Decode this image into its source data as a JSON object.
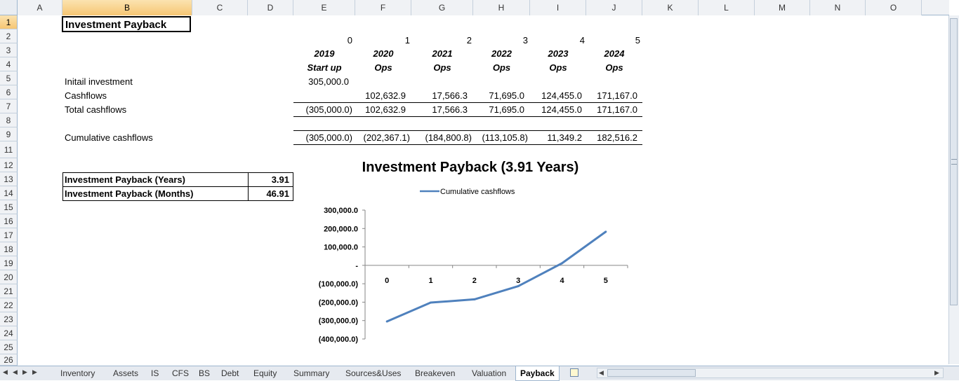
{
  "columns": [
    "A",
    "B",
    "C",
    "D",
    "E",
    "F",
    "G",
    "H",
    "I",
    "J",
    "K",
    "L",
    "M",
    "N",
    "O"
  ],
  "rows": [
    "1",
    "2",
    "3",
    "4",
    "5",
    "6",
    "7",
    "8",
    "9",
    "11",
    "12",
    "13",
    "14",
    "15",
    "16",
    "17",
    "18",
    "19",
    "20",
    "21",
    "22",
    "23",
    "24",
    "25",
    "26"
  ],
  "sheet": {
    "title": "Investment Payback",
    "periods": [
      "0",
      "1",
      "2",
      "3",
      "4",
      "5"
    ],
    "years": [
      "2019",
      "2020",
      "2021",
      "2022",
      "2023",
      "2024"
    ],
    "phases": [
      "Start up",
      "Ops",
      "Ops",
      "Ops",
      "Ops",
      "Ops"
    ],
    "initial_label": "Initail investment",
    "initial_value": "305,000.0",
    "cashflows_label": "Cashflows",
    "cashflows": [
      "102,632.9",
      "17,566.3",
      "71,695.0",
      "124,455.0",
      "171,167.0"
    ],
    "total_label": "Total cashflows",
    "total": [
      "(305,000.0)",
      "102,632.9",
      "17,566.3",
      "71,695.0",
      "124,455.0",
      "171,167.0"
    ],
    "cumulative_label": "Cumulative cashflows",
    "cumulative": [
      "(305,000.0)",
      "(202,367.1)",
      "(184,800.8)",
      "(113,105.8)",
      "11,349.2",
      "182,516.2"
    ],
    "payback_years_label": "Investment Payback (Years)",
    "payback_years_value": "3.91",
    "payback_months_label": "Investment Payback (Months)",
    "payback_months_value": "46.91"
  },
  "chart_data": {
    "type": "line",
    "title": "Investment Payback (3.91 Years)",
    "categories": [
      "0",
      "1",
      "2",
      "3",
      "4",
      "5"
    ],
    "series": [
      {
        "name": "Cumulative cashflows",
        "values": [
          -305000.0,
          -202367.1,
          -184800.8,
          -113105.8,
          11349.2,
          182516.2
        ],
        "color": "#4f81bd"
      }
    ],
    "ylim": [
      -400000,
      300000
    ],
    "yticks": [
      300000,
      200000,
      100000,
      0,
      -100000,
      -200000,
      -300000,
      -400000
    ],
    "ytick_labels": [
      "300,000.0",
      "200,000.0",
      "100,000.0",
      "-",
      "(100,000.0)",
      "(200,000.0)",
      "(300,000.0)",
      "(400,000.0)"
    ],
    "legend": "top",
    "grid": false
  },
  "tabs": [
    "Inventory",
    "Assets",
    "IS",
    "CFS",
    "BS",
    "Debt",
    "Equity",
    "Summary",
    "Sources&Uses",
    "Breakeven",
    "Valuation",
    "Payback"
  ],
  "active_tab": "Payback"
}
